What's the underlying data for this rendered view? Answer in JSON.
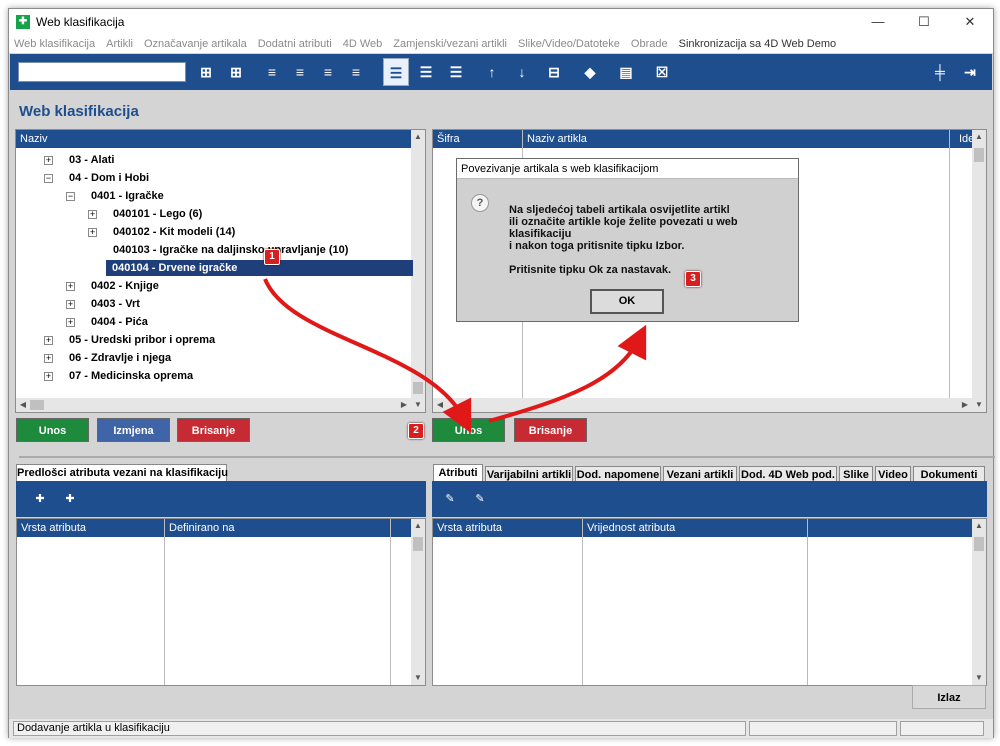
{
  "window": {
    "title": "Web klasifikacija",
    "min": "—",
    "max": "☐",
    "close": "✕"
  },
  "menu": [
    "Web klasifikacija",
    "Artikli",
    "Označavanje artikala",
    "Dodatni atributi",
    "4D Web",
    "Zamjenski/vezani artikli",
    "Slike/Video/Datoteke",
    "Obrade",
    "Sinkronizacija sa 4D Web Demo"
  ],
  "section_title": "Web klasifikacija",
  "left_grid": {
    "header": "Naziv"
  },
  "tree": [
    {
      "label": "03 - Alati",
      "expander": "+"
    },
    {
      "label": "04 - Dom i Hobi",
      "expander": "−"
    },
    {
      "label": "0401 - Igračke",
      "expander": "−"
    },
    {
      "label": "040101 - Lego (6)",
      "expander": "+"
    },
    {
      "label": "040102 - Kit modeli (14)",
      "expander": "+"
    },
    {
      "label": "040103 - Igračke na daljinsko upravljanje (10)",
      "expander": ""
    },
    {
      "label": "040104 - Drvene igračke",
      "expander": ""
    },
    {
      "label": "0402 - Knjige",
      "expander": "+"
    },
    {
      "label": "0403 - Vrt",
      "expander": "+"
    },
    {
      "label": "0404 - Pića",
      "expander": "+"
    },
    {
      "label": "05 - Uredski pribor i oprema",
      "expander": "+"
    },
    {
      "label": "06 - Zdravlje i njega",
      "expander": "+"
    },
    {
      "label": "07 - Medicinska oprema",
      "expander": "+"
    }
  ],
  "right_grid": {
    "col1": "Šifra",
    "col2": "Naziv artikla",
    "col3": "Ide"
  },
  "buttons": {
    "unos_left": "Unos",
    "izmjena": "Izmjena",
    "brisanje_left": "Brisanje",
    "unos_right": "Unos",
    "brisanje_right": "Brisanje",
    "izlaz": "Izlaz"
  },
  "dialog": {
    "title": "Povezivanje artikala s web klasifikacijom",
    "line1": "Na sljedećoj tabeli artikala osvijetlite artikl",
    "line2": "ili označite artikle koje želite povezati u web klasifikaciju",
    "line3": "i nakon toga pritisnite tipku Izbor.",
    "line4": "Pritisnite tipku Ok za nastavak.",
    "ok": "OK",
    "icon": "?"
  },
  "badges": {
    "b1": "1",
    "b2": "2",
    "b3": "3"
  },
  "bottom_left": {
    "tab": "Predlošci atributa vezani na klasifikaciju",
    "col1": "Vrsta atributa",
    "col2": "Definirano na"
  },
  "bottom_right": {
    "tabs": [
      "Atributi",
      "Varijabilni artikli",
      "Dod. napomene",
      "Vezani artikli",
      "Dod. 4D Web pod.",
      "Slike",
      "Video",
      "Dokumenti"
    ],
    "col1": "Vrsta atributa",
    "col2": "Vrijednost atributa"
  },
  "status": {
    "text": "Dodavanje artikla u klasifikaciju"
  },
  "colors": {
    "brand_blue": "#1f4e8f",
    "green": "#1e8a3c",
    "red": "#c62a32",
    "selected": "#1f3f7a",
    "badge": "#d81e1e"
  }
}
